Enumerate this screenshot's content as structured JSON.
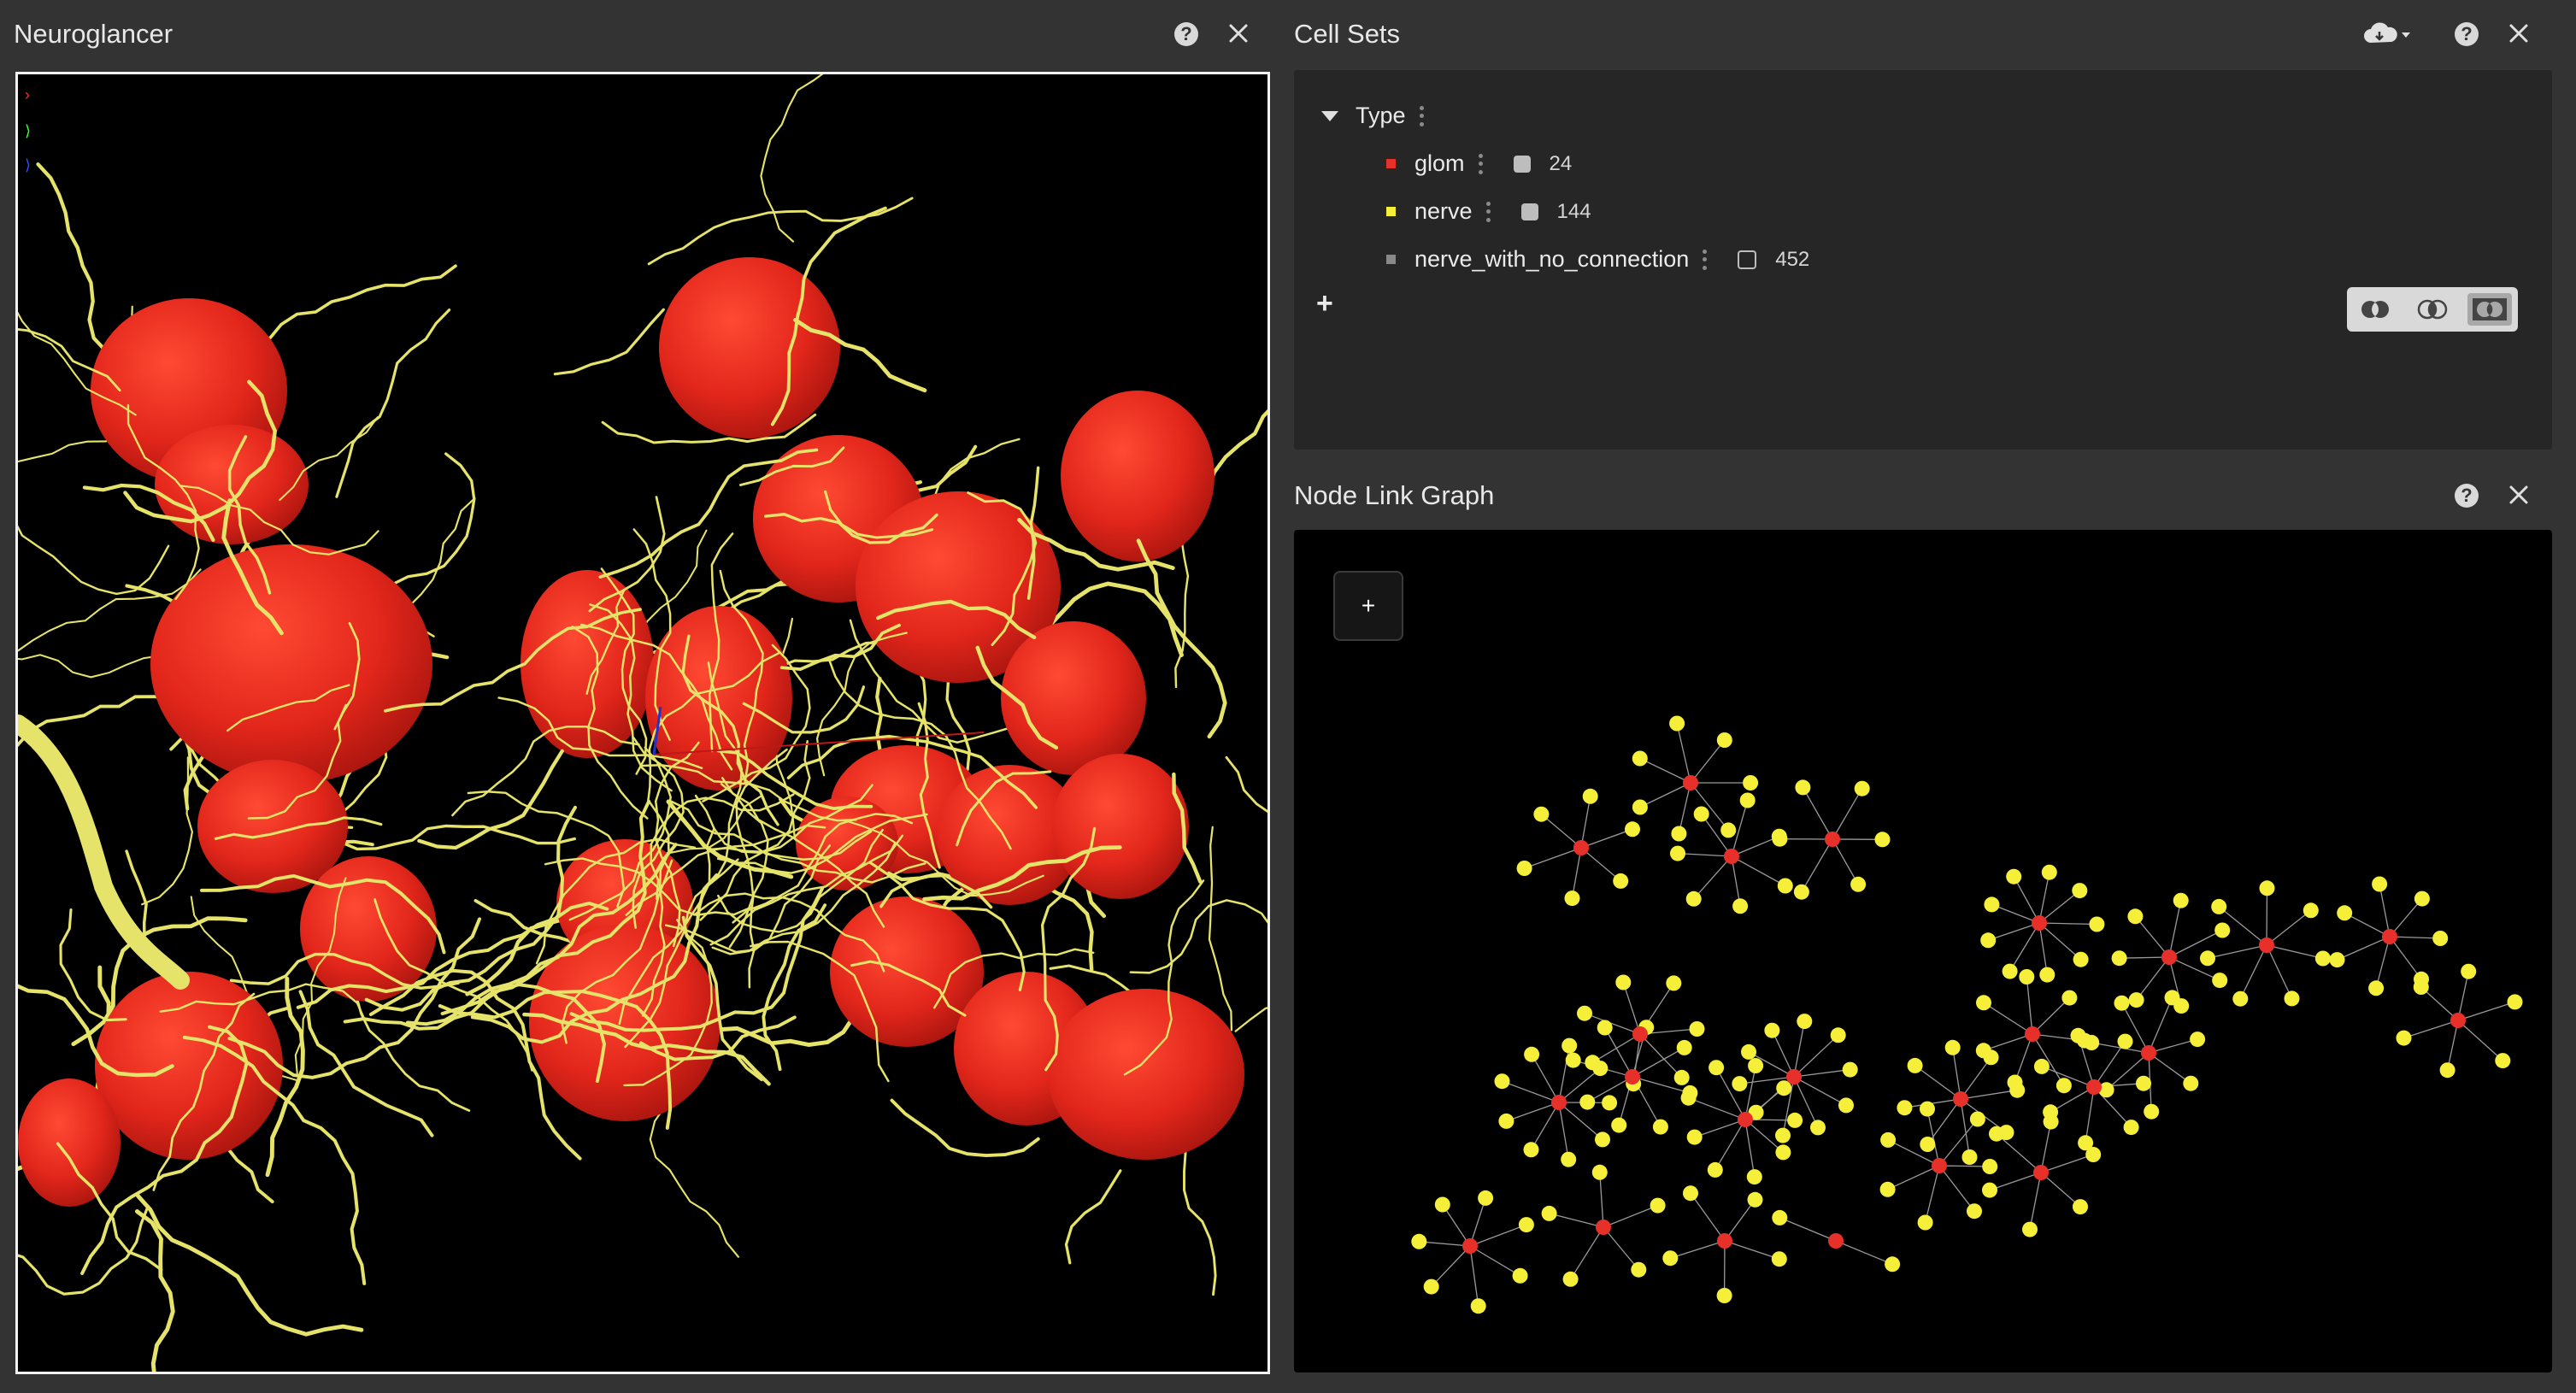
{
  "neuroglancer": {
    "title": "Neuroglancer",
    "axis_glyphs": [
      "›",
      "⟩",
      "⟩"
    ]
  },
  "cell_sets": {
    "title": "Cell Sets",
    "group": "Type",
    "items": [
      {
        "name": "glom",
        "color": "#e8302a",
        "count": "24",
        "checked": true
      },
      {
        "name": "nerve",
        "color": "#f5ef3a",
        "count": "144",
        "checked": true
      },
      {
        "name": "nerve_with_no_connection",
        "color": "#888888",
        "count": "452",
        "checked": false
      }
    ],
    "add_label": "+"
  },
  "node_link": {
    "title": "Node Link Graph",
    "add_label": "+"
  },
  "colors": {
    "background": "#333333",
    "glom": "#e8302a",
    "nerve": "#f5ef3a"
  },
  "icons": {
    "help": "question-icon",
    "close": "close-icon",
    "download": "cloud-download-icon"
  }
}
